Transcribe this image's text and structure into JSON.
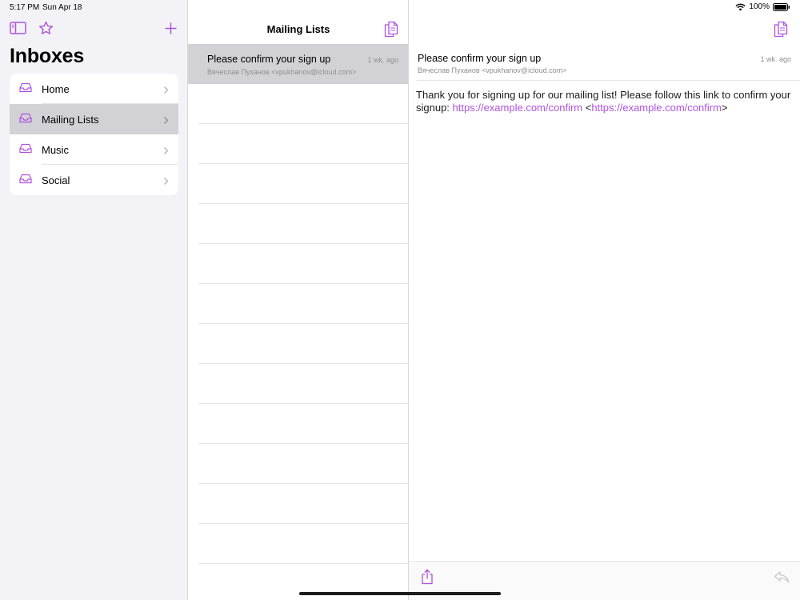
{
  "status_bar": {
    "time": "5:17 PM",
    "date": "Sun Apr 18",
    "battery": "100%"
  },
  "sidebar": {
    "title": "Inboxes",
    "items": [
      {
        "label": "Home",
        "selected": false
      },
      {
        "label": "Mailing Lists",
        "selected": true
      },
      {
        "label": "Music",
        "selected": false
      },
      {
        "label": "Social",
        "selected": false
      }
    ]
  },
  "list": {
    "title": "Mailing Lists",
    "messages": [
      {
        "subject": "Please confirm your sign up",
        "from": "Вячеслав Пуханов <vpukhanov@icloud.com>",
        "ago": "1 wk. ago"
      }
    ]
  },
  "detail": {
    "subject": "Please confirm your sign up",
    "from": "Вячеслав Пуханов <vpukhanov@icloud.com>",
    "ago": "1 wk. ago",
    "body_text": "Thank you for signing up for our mailing list! Please follow this link to confirm your signup: ",
    "link1": "https://example.com/confirm",
    "lt": " <",
    "link2": "https://example.com/confirm",
    "gt": ">"
  },
  "colors": {
    "accent": "#af52de",
    "selected": "#d1d1d6",
    "background": "#f2f2f7"
  }
}
